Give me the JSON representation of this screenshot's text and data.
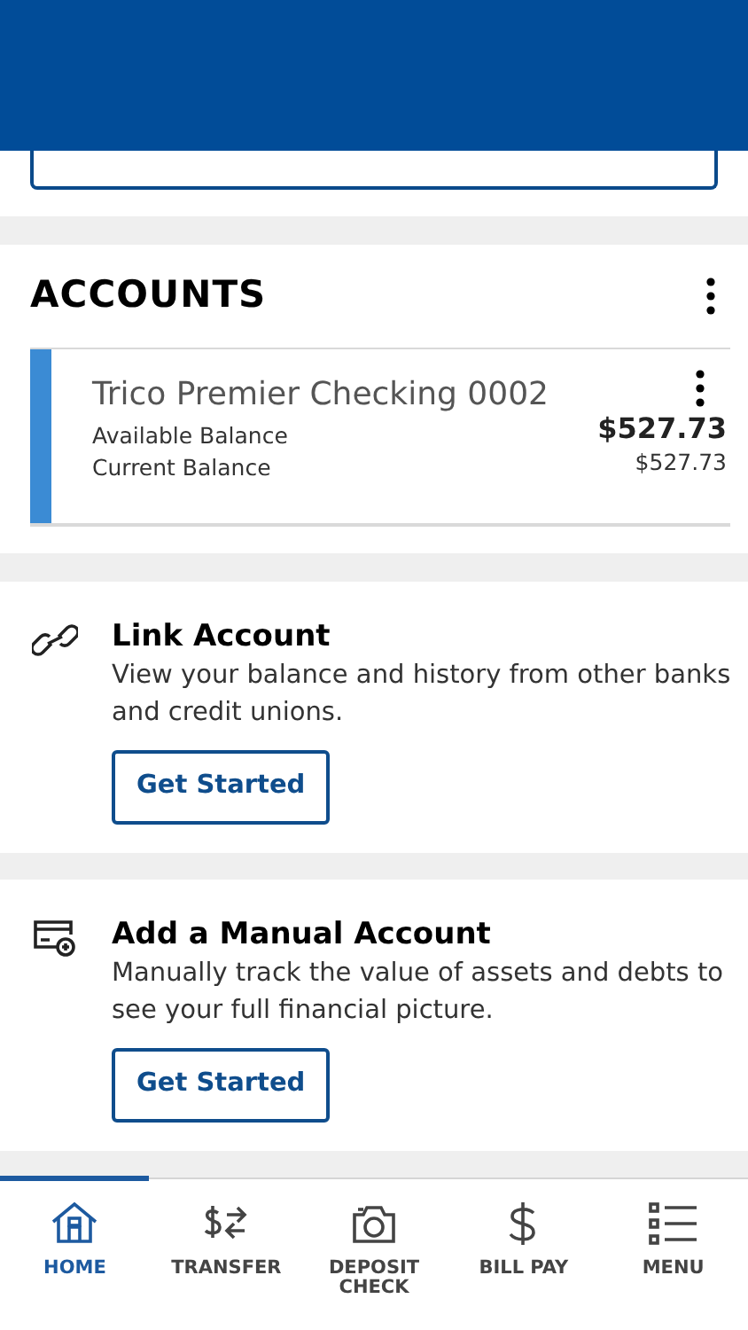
{
  "accounts_section": {
    "title": "ACCOUNTS",
    "accounts": [
      {
        "name": "Trico Premier Checking 0002",
        "color": "#3b8bd4",
        "available_label": "Available Balance",
        "available": "$527.73",
        "current_label": "Current Balance",
        "current": "$527.73"
      }
    ]
  },
  "promo_cards": [
    {
      "kind": "link",
      "title": "Link Account",
      "text": "View your balance and history from other banks and credit unions.",
      "button": "Get Started"
    },
    {
      "kind": "manual",
      "title": "Add a Manual Account",
      "text": "Manually track the value of assets and debts to see your full financial picture.",
      "button": "Get Started"
    }
  ],
  "nav": [
    {
      "kind": "home",
      "label": "HOME",
      "selected": true
    },
    {
      "kind": "transfer",
      "label": "TRANSFER",
      "selected": false
    },
    {
      "kind": "camera",
      "label": "DEPOSIT CHECK",
      "selected": false
    },
    {
      "kind": "dollar",
      "label": "BILL PAY",
      "selected": false
    },
    {
      "kind": "menu",
      "label": "MENU",
      "selected": false
    }
  ]
}
